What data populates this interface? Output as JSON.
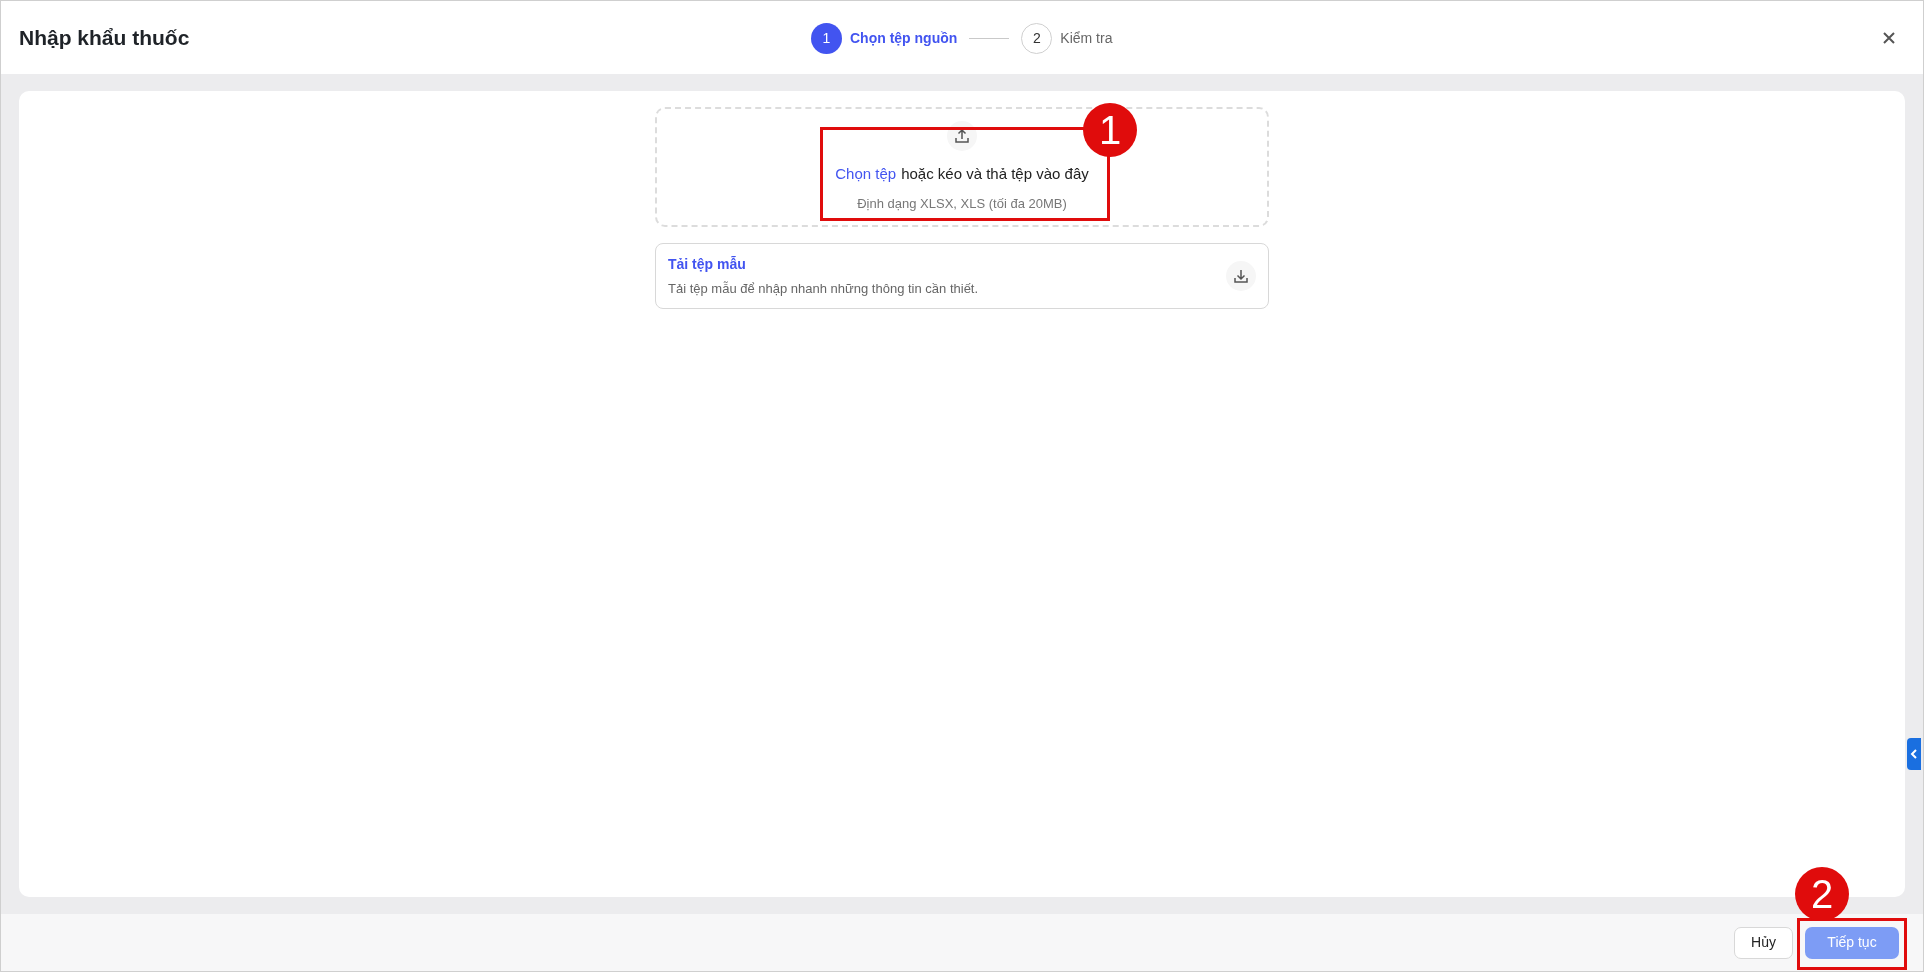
{
  "window": {
    "title": "Nhập khẩu thuốc"
  },
  "steps": [
    {
      "number": "1",
      "label": "Chọn tệp nguồn",
      "selected": true
    },
    {
      "number": "2",
      "label": "Kiểm tra",
      "selected": false
    }
  ],
  "dropzone": {
    "link": "Chọn tệp",
    "text": "hoặc kéo và thả tệp vào đây",
    "hint": "Định dạng XLSX, XLS (tối đa 20MB)"
  },
  "template": {
    "title": "Tải tệp mẫu",
    "description": "Tải tệp mẫu để nhập nhanh những thông tin cần thiết."
  },
  "buttons": [
    {
      "label": "Hủy",
      "kind": "secondary",
      "disabled": false
    },
    {
      "label": "Tiếp tục",
      "kind": "primary",
      "disabled": true
    }
  ],
  "annotations": [
    "1",
    "2"
  ]
}
